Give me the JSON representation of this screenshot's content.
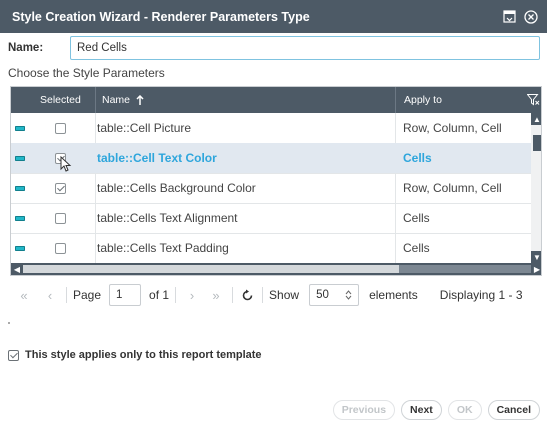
{
  "window": {
    "title": "Style Creation Wizard - Renderer Parameters Type",
    "icons": [
      "restore-icon",
      "close-icon"
    ]
  },
  "name_field": {
    "label": "Name:",
    "value": "Red Cells"
  },
  "subheading": "Choose the Style Parameters",
  "table": {
    "columns": {
      "selected": "Selected",
      "name": "Name",
      "apply_to": "Apply to"
    },
    "sort_icon": "sort-ascending-arrow-icon",
    "filter_icon": "filter-clear-icon",
    "rows": [
      {
        "name": "table::Cell Picture",
        "apply_to": "Row, Column, Cell",
        "checked": false,
        "highlighted": false
      },
      {
        "name": "table::Cell Text Color",
        "apply_to": "Cells",
        "checked": true,
        "highlighted": true
      },
      {
        "name": "table::Cells Background Color",
        "apply_to": "Row, Column, Cell",
        "checked": true,
        "highlighted": false
      },
      {
        "name": "table::Cells Text Alignment",
        "apply_to": "Cells",
        "checked": false,
        "highlighted": false
      },
      {
        "name": "table::Cells Text Padding",
        "apply_to": "Cells",
        "checked": false,
        "highlighted": false
      }
    ]
  },
  "pager": {
    "first": "«",
    "prev": "‹",
    "page_label": "Page",
    "page_value": "1",
    "of_label": "of 1",
    "next": "›",
    "last": "»",
    "refresh_icon": "refresh-icon",
    "show_label": "Show",
    "page_size": "50",
    "elements_label": "elements",
    "displaying": "Displaying 1 - 3"
  },
  "applies_checkbox": {
    "label": "This style applies only to this report template",
    "checked": true
  },
  "footer": {
    "previous": "Previous",
    "next": "Next",
    "ok": "OK",
    "cancel": "Cancel"
  },
  "colors": {
    "header_bg": "#4d5a66",
    "accent": "#2ea6dc",
    "selected_row_bg": "#e1e8f0",
    "indicator": "#22b7c8"
  }
}
